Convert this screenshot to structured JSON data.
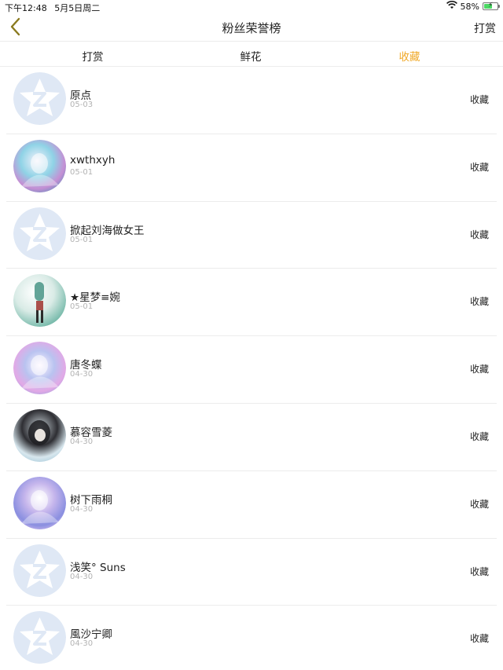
{
  "status_bar": {
    "time": "下午12:48",
    "date": "5月5日周二",
    "battery": "58%",
    "battery_level": 0.58,
    "icons": [
      "wifi-icon",
      "battery-icon"
    ]
  },
  "nav": {
    "title": "粉丝荣誉榜",
    "right_label": "打赏",
    "back_icon": "chevron-left-icon",
    "accent_color": "#f0a928"
  },
  "tabs": [
    {
      "label": "打赏",
      "active": false
    },
    {
      "label": "鲜花",
      "active": false
    },
    {
      "label": "收藏",
      "active": true
    }
  ],
  "fans": [
    {
      "name": "原点",
      "date": "05-03",
      "action": "收藏",
      "avatar": "default-avatar"
    },
    {
      "name": "xwthxyh",
      "date": "05-01",
      "action": "收藏",
      "avatar": "anime-avatar-blue"
    },
    {
      "name": "掀起刘海做女王",
      "date": "05-01",
      "action": "收藏",
      "avatar": "default-avatar"
    },
    {
      "name": "★星梦≡婉",
      "date": "05-01",
      "action": "收藏",
      "avatar": "anime-avatar-green"
    },
    {
      "name": "唐冬蝶",
      "date": "04-30",
      "action": "收藏",
      "avatar": "anime-avatar-purple"
    },
    {
      "name": "慕容雪菱",
      "date": "04-30",
      "action": "收藏",
      "avatar": "anime-avatar-dark"
    },
    {
      "name": "树下雨桐",
      "date": "04-30",
      "action": "收藏",
      "avatar": "anime-avatar-violet"
    },
    {
      "name": "浅笑° Suns",
      "date": "04-30",
      "action": "收藏",
      "avatar": "default-avatar"
    },
    {
      "name": "風沙宁卿",
      "date": "04-30",
      "action": "收藏",
      "avatar": "default-avatar"
    }
  ]
}
